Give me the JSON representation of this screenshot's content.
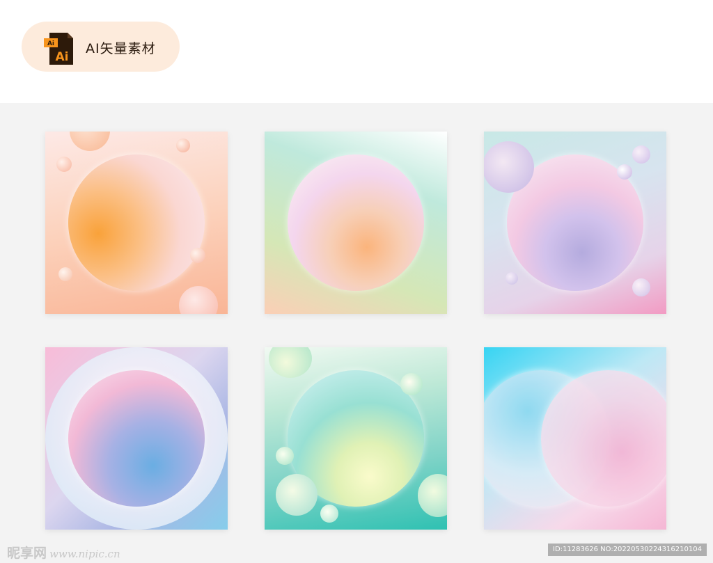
{
  "badge": {
    "label": "AI矢量素材",
    "icon": "ai-file-icon",
    "icon_text": "Ai",
    "icon_small_text": "Ai"
  },
  "footer": {
    "logo_text": "昵享网",
    "url": "www.nipic.cn",
    "id_text": "ID:11283626 NO:20220530224316210104"
  },
  "colors": {
    "badge_bg": "#fdebdc",
    "gallery_bg": "#f3f3f3",
    "ai_orange": "#f7941d",
    "ai_dark": "#2d1a0a"
  }
}
